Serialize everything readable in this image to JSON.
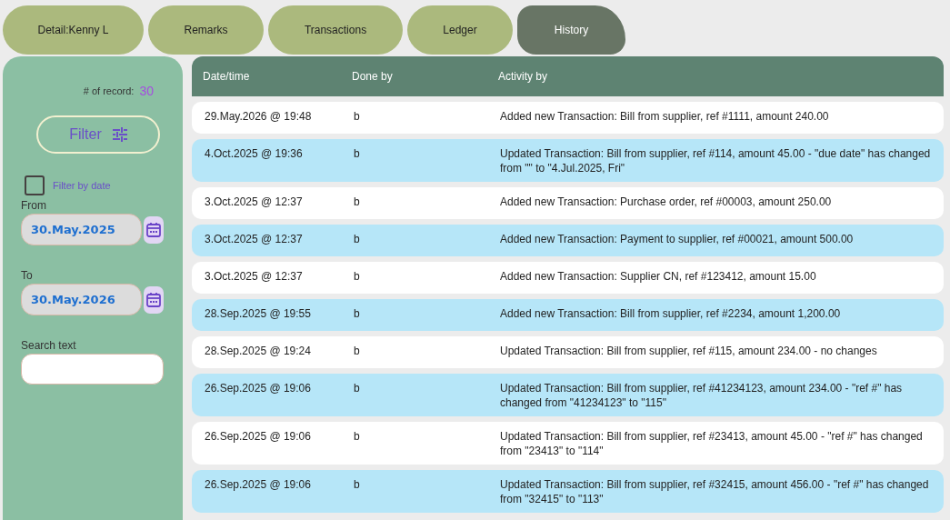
{
  "tabs": [
    {
      "label": "Detail:Kenny L",
      "selected": false
    },
    {
      "label": "Remarks",
      "selected": false
    },
    {
      "label": "Transactions",
      "selected": false
    },
    {
      "label": "Ledger",
      "selected": false
    },
    {
      "label": "History",
      "selected": true
    }
  ],
  "filter_panel": {
    "record_count_label": "# of record:",
    "record_count": "30",
    "filter_button": "Filter",
    "filter_by_date": {
      "label": "Filter by date",
      "checked": false
    },
    "from": {
      "label": "From",
      "value": "30.May.2025"
    },
    "to": {
      "label": "To",
      "value": "30.May.2026"
    },
    "search": {
      "label": "Search text"
    }
  },
  "table": {
    "columns": [
      "Date/time",
      "Done by",
      "Activity by"
    ],
    "rows": [
      {
        "date_time": "29.May.2026 @ 19:48",
        "done_by": "b",
        "activity": "Added new Transaction: Bill from supplier, ref #1111, amount 240.00"
      },
      {
        "date_time": "4.Oct.2025 @ 19:36",
        "done_by": "b",
        "activity": "Updated Transaction: Bill from supplier, ref #114, amount 45.00 - \"due date\" has changed from \"\" to \"4.Jul.2025, Fri\""
      },
      {
        "date_time": "3.Oct.2025 @ 12:37",
        "done_by": "b",
        "activity": "Added new Transaction: Purchase order, ref #00003, amount 250.00"
      },
      {
        "date_time": "3.Oct.2025 @ 12:37",
        "done_by": "b",
        "activity": "Added new Transaction: Payment to supplier, ref #00021, amount 500.00"
      },
      {
        "date_time": "3.Oct.2025 @ 12:37",
        "done_by": "b",
        "activity": "Added new Transaction: Supplier CN, ref #123412, amount 15.00"
      },
      {
        "date_time": "28.Sep.2025 @ 19:55",
        "done_by": "b",
        "activity": "Added new Transaction: Bill from supplier, ref #2234, amount 1,200.00"
      },
      {
        "date_time": "28.Sep.2025 @ 19:24",
        "done_by": "b",
        "activity": "Updated Transaction: Bill from supplier, ref #115, amount 234.00 - no changes"
      },
      {
        "date_time": "26.Sep.2025 @ 19:06",
        "done_by": "b",
        "activity": "Updated Transaction: Bill from supplier, ref #41234123, amount 234.00 - \"ref #\" has changed from \"41234123\" to \"115\""
      },
      {
        "date_time": "26.Sep.2025 @ 19:06",
        "done_by": "b",
        "activity": "Updated Transaction: Bill from supplier, ref #23413, amount 45.00 - \"ref #\" has changed from \"23413\" to \"114\""
      },
      {
        "date_time": "26.Sep.2025 @ 19:06",
        "done_by": "b",
        "activity": "Updated Transaction: Bill from supplier, ref #32415, amount 456.00 - \"ref #\" has changed from \"32415\" to \"113\""
      }
    ]
  }
}
